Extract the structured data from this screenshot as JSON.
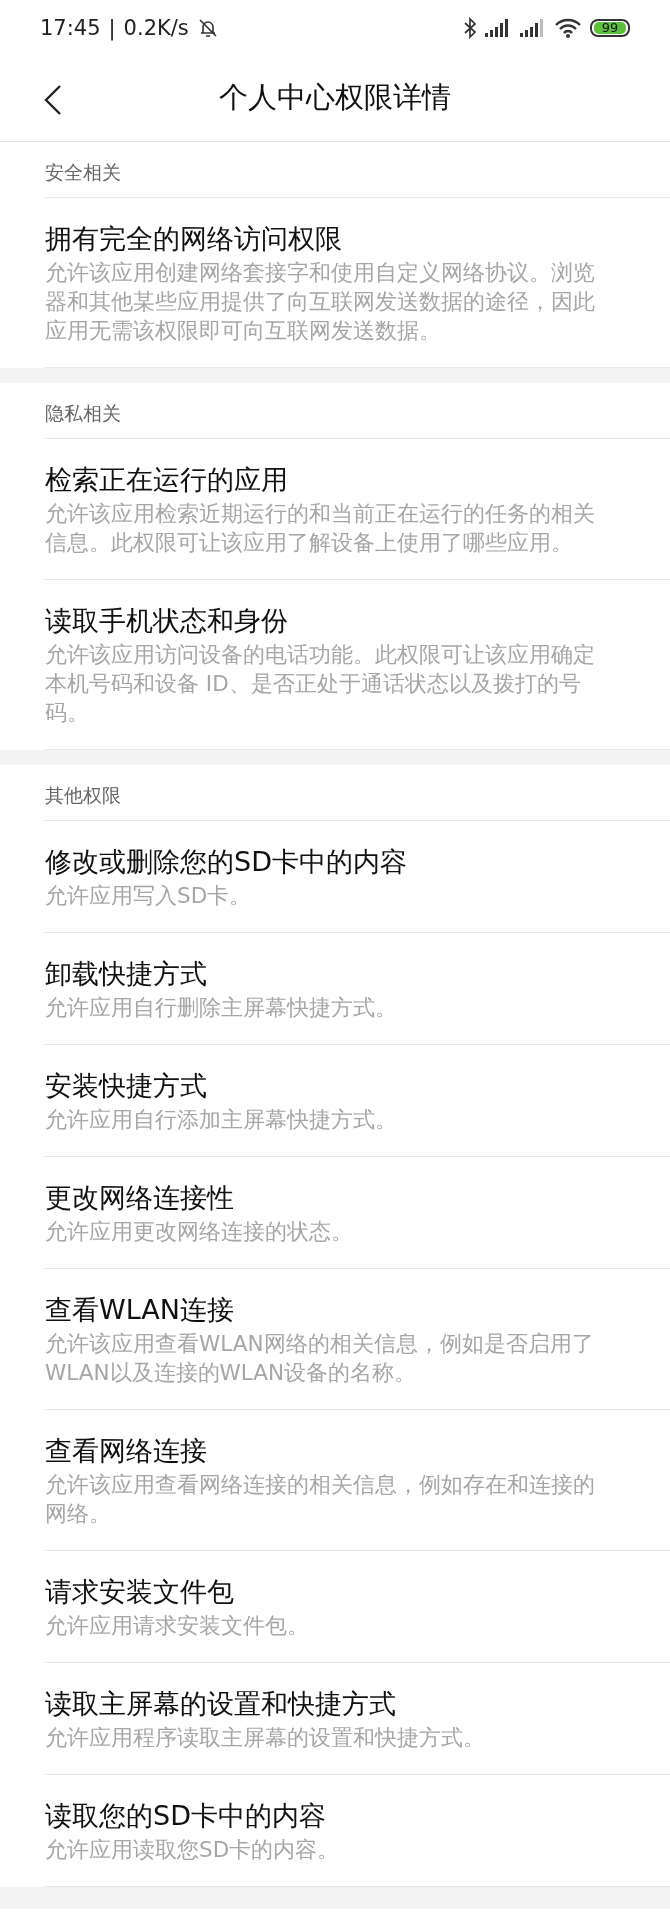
{
  "status_bar": {
    "time": "17:45",
    "separator": "|",
    "net_speed": "0.2K/s",
    "battery": "99"
  },
  "header": {
    "title": "个人中心权限详情"
  },
  "sections": [
    {
      "label": "安全相关",
      "items": [
        {
          "title": "拥有完全的网络访问权限",
          "description": "允许该应用创建网络套接字和使用自定义网络协议。浏览器和其他某些应用提供了向互联网发送数据的途径，因此应用无需该权限即可向互联网发送数据。"
        }
      ]
    },
    {
      "label": "隐私相关",
      "items": [
        {
          "title": "检索正在运行的应用",
          "description": "允许该应用检索近期运行的和当前正在运行的任务的相关信息。此权限可让该应用了解设备上使用了哪些应用。"
        },
        {
          "title": "读取手机状态和身份",
          "description": "允许该应用访问设备的电话功能。此权限可让该应用确定本机号码和设备 ID、是否正处于通话状态以及拨打的号码。"
        }
      ]
    },
    {
      "label": "其他权限",
      "items": [
        {
          "title": "修改或删除您的SD卡中的内容",
          "description": "允许应用写入SD卡。"
        },
        {
          "title": "卸载快捷方式",
          "description": "允许应用自行删除主屏幕快捷方式。"
        },
        {
          "title": "安装快捷方式",
          "description": "允许应用自行添加主屏幕快捷方式。"
        },
        {
          "title": "更改网络连接性",
          "description": "允许应用更改网络连接的状态。"
        },
        {
          "title": "查看WLAN连接",
          "description": "允许该应用查看WLAN网络的相关信息，例如是否启用了WLAN以及连接的WLAN设备的名称。"
        },
        {
          "title": "查看网络连接",
          "description": "允许该应用查看网络连接的相关信息，例如存在和连接的网络。"
        },
        {
          "title": "请求安装文件包",
          "description": "允许应用请求安装文件包。"
        },
        {
          "title": "读取主屏幕的设置和快捷方式",
          "description": "允许应用程序读取主屏幕的设置和快捷方式。"
        },
        {
          "title": "读取您的SD卡中的内容",
          "description": "允许应用读取您SD卡的内容。"
        }
      ]
    }
  ]
}
